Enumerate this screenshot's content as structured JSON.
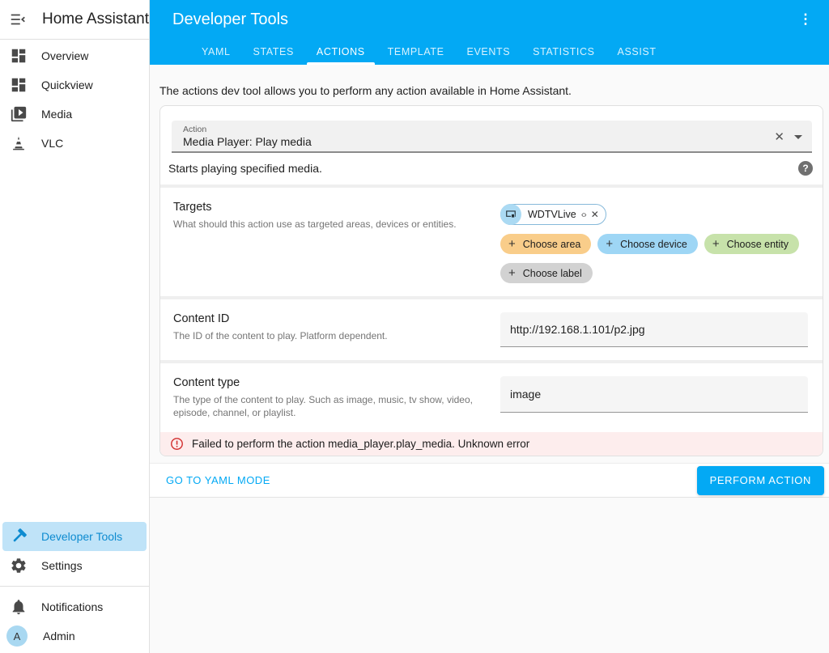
{
  "sidebar": {
    "title": "Home Assistant",
    "items": [
      {
        "label": "Overview",
        "icon": "dashboard-icon"
      },
      {
        "label": "Quickview",
        "icon": "dashboard-icon"
      },
      {
        "label": "Media",
        "icon": "media-icon"
      },
      {
        "label": "VLC",
        "icon": "vlc-cone-icon"
      }
    ],
    "bottom_items": [
      {
        "label": "Developer Tools",
        "icon": "hammer-icon",
        "active": true
      },
      {
        "label": "Settings",
        "icon": "gear-icon",
        "active": false
      }
    ],
    "footer_items": [
      {
        "label": "Notifications",
        "icon": "bell-icon"
      },
      {
        "label": "Admin",
        "icon": "avatar"
      }
    ],
    "avatar_initial": "A"
  },
  "header": {
    "title": "Developer Tools",
    "tabs": [
      {
        "label": "YAML",
        "active": false
      },
      {
        "label": "STATES",
        "active": false
      },
      {
        "label": "ACTIONS",
        "active": true
      },
      {
        "label": "TEMPLATE",
        "active": false
      },
      {
        "label": "EVENTS",
        "active": false
      },
      {
        "label": "STATISTICS",
        "active": false
      },
      {
        "label": "ASSIST",
        "active": false
      }
    ]
  },
  "main": {
    "intro": "The actions dev tool allows you to perform any action available in Home Assistant.",
    "action_field": {
      "label": "Action",
      "value": "Media Player: Play media"
    },
    "action_description": "Starts playing specified media.",
    "targets": {
      "label": "Targets",
      "description": "What should this action use as targeted areas, devices or entities.",
      "selected_entity": {
        "name": "WDTVLive",
        "expand_glyph": "‹›",
        "close_glyph": "✕"
      },
      "choose_buttons": [
        {
          "label": "Choose area"
        },
        {
          "label": "Choose device"
        },
        {
          "label": "Choose entity"
        },
        {
          "label": "Choose label"
        }
      ]
    },
    "content_id": {
      "label": "Content ID",
      "description": "The ID of the content to play. Platform dependent.",
      "value": "http://192.168.1.101/p2.jpg"
    },
    "content_type": {
      "label": "Content type",
      "description": "The type of the content to play. Such as image, music, tv show, video, episode, channel, or playlist.",
      "value": "image"
    },
    "error": {
      "message": "Failed to perform the action media_player.play_media. Unknown error"
    },
    "footer": {
      "yaml_mode_label": "GO TO YAML MODE",
      "perform_label": "PERFORM ACTION"
    }
  },
  "icons": {
    "overflow_menu": "⋮",
    "clear_x": "✕"
  },
  "colors": {
    "header_blue": "#03a9f4",
    "accent_blue": "#03a9f4",
    "sidebar_active_bg": "#bfe3f8",
    "sidebar_active_text": "#0d8bd0",
    "chip_area": "#f9cd8a",
    "chip_device": "#9ed6f5",
    "chip_entity": "#c7e2aa",
    "chip_label": "#d2d2d2",
    "error_bg": "#fdeded",
    "error_red": "#d22f2f",
    "field_fill": "#f1f1f1",
    "content_bg": "#fafafa"
  }
}
